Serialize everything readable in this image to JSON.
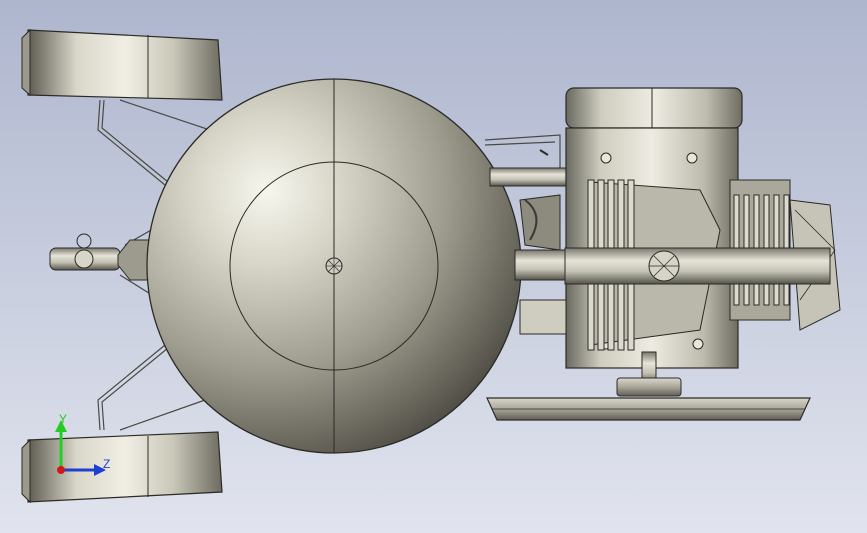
{
  "viewport": {
    "background_top": "#aeb6ce",
    "background_bottom": "#e1e4ee"
  },
  "triad": {
    "y_label": "Y",
    "z_label": "Z",
    "y_color": "#22cc22",
    "z_color": "#1f3fd0",
    "x_color": "#d01818"
  },
  "model": {
    "tank": "air-receiver-tank",
    "wheels": "wheel",
    "motor": "electric-motor",
    "pump": "compressor-head",
    "pulley": "belt-pulley"
  }
}
